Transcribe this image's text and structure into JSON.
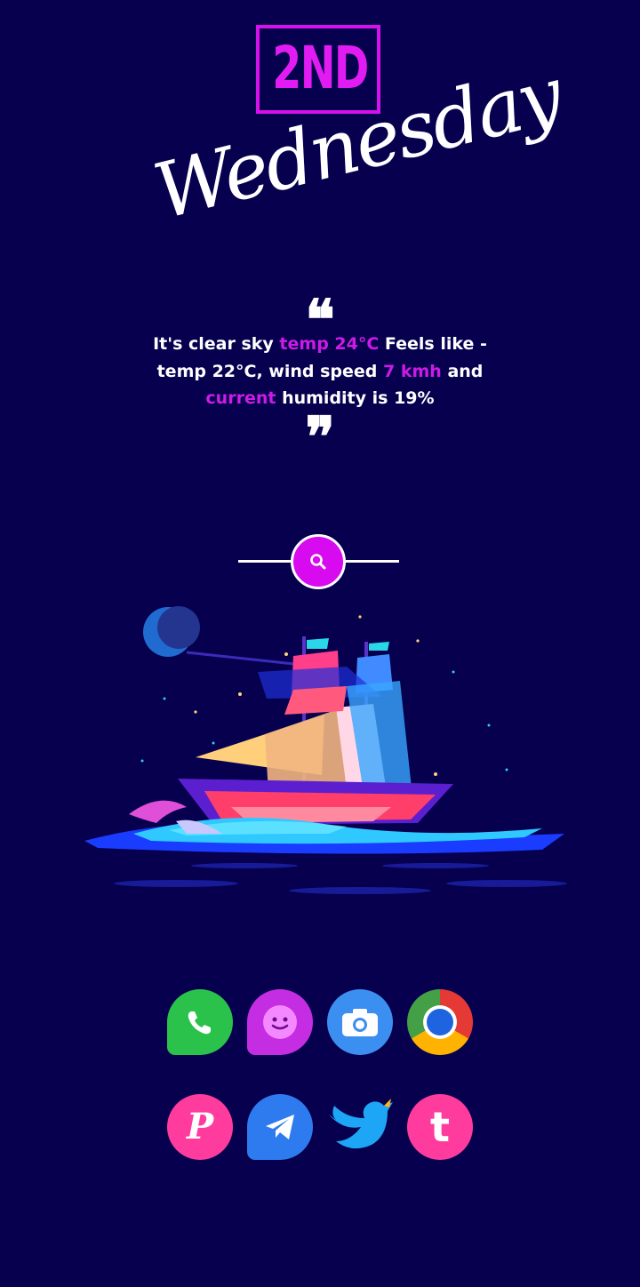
{
  "date_widget": {
    "day_ordinal": "2ND",
    "weekday": "Wednesday"
  },
  "weather_quote": {
    "part1": "It's clear sky",
    "temp": "temp 24°C",
    "part2": "Feels like - temp 22°C, wind speed",
    "wind": "7 kmh",
    "part3": "and",
    "current": "current",
    "part4": "humidity is  19%"
  },
  "colors": {
    "background": "#06004f",
    "accent": "#d80af0"
  },
  "search": {
    "icon": "search-icon"
  },
  "dock_row1": [
    {
      "name": "phone-app-icon",
      "icon": "whatsapp-phone-icon"
    },
    {
      "name": "messages-app-icon",
      "icon": "smiley-chat-icon"
    },
    {
      "name": "camera-app-icon",
      "icon": "camera-icon"
    },
    {
      "name": "chrome-app-icon",
      "icon": "chrome-icon"
    }
  ],
  "dock_row2": [
    {
      "name": "pinterest-app-icon",
      "icon": "letter-p-icon"
    },
    {
      "name": "telegram-app-icon",
      "icon": "paper-plane-icon"
    },
    {
      "name": "twitter-app-icon",
      "icon": "bird-icon"
    },
    {
      "name": "tumblr-app-icon",
      "icon": "letter-t-icon"
    }
  ]
}
